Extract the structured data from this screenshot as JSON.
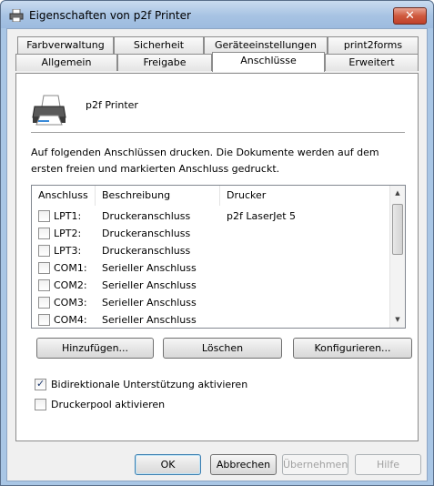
{
  "window": {
    "title": "Eigenschaften von p2f Printer",
    "close_symbol": "✕"
  },
  "tabs_back": [
    {
      "label": "Farbverwaltung"
    },
    {
      "label": "Sicherheit"
    },
    {
      "label": "Geräteeinstellungen"
    },
    {
      "label": "print2forms"
    }
  ],
  "tabs_front": [
    {
      "label": "Allgemein"
    },
    {
      "label": "Freigabe"
    },
    {
      "label": "Anschlüsse",
      "active": true
    },
    {
      "label": "Erweitert"
    }
  ],
  "printer": {
    "name": "p2f Printer"
  },
  "description": "Auf folgenden Anschlüssen drucken. Die Dokumente werden auf dem ersten freien und markierten Anschluss gedruckt.",
  "list": {
    "columns": [
      "Anschluss",
      "Beschreibung",
      "Drucker"
    ],
    "rows": [
      {
        "port": "LPT1:",
        "description": "Druckeranschluss",
        "printer": "p2f LaserJet 5",
        "checked": false
      },
      {
        "port": "LPT2:",
        "description": "Druckeranschluss",
        "printer": "",
        "checked": false
      },
      {
        "port": "LPT3:",
        "description": "Druckeranschluss",
        "printer": "",
        "checked": false
      },
      {
        "port": "COM1:",
        "description": "Serieller Anschluss",
        "printer": "",
        "checked": false
      },
      {
        "port": "COM2:",
        "description": "Serieller Anschluss",
        "printer": "",
        "checked": false
      },
      {
        "port": "COM3:",
        "description": "Serieller Anschluss",
        "printer": "",
        "checked": false
      },
      {
        "port": "COM4:",
        "description": "Serieller Anschluss",
        "printer": "",
        "checked": false
      }
    ]
  },
  "actions": {
    "add": "Hinzufügen...",
    "delete": "Löschen",
    "configure": "Konfigurieren..."
  },
  "options": {
    "bidirectional": {
      "label": "Bidirektionale Unterstützung aktivieren",
      "checked": true
    },
    "pool": {
      "label": "Druckerpool aktivieren",
      "checked": false
    }
  },
  "footer": {
    "ok": "OK",
    "cancel": "Abbrechen",
    "apply": "Übernehmen",
    "help": "Hilfe"
  },
  "colors": {
    "title_bar": "#a9c6e5",
    "client": "#f0f0f0",
    "close": "#cf5a3e"
  }
}
